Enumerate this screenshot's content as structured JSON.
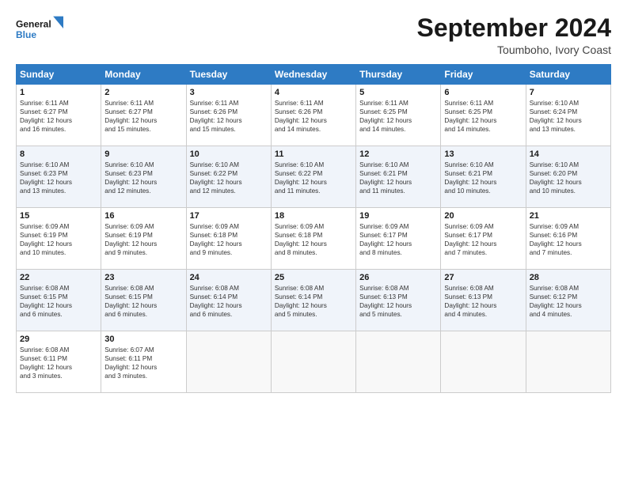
{
  "logo": {
    "line1": "General",
    "line2": "Blue"
  },
  "title": "September 2024",
  "subtitle": "Toumboho, Ivory Coast",
  "header_days": [
    "Sunday",
    "Monday",
    "Tuesday",
    "Wednesday",
    "Thursday",
    "Friday",
    "Saturday"
  ],
  "weeks": [
    [
      {
        "day": "1",
        "lines": [
          "Sunrise: 6:11 AM",
          "Sunset: 6:27 PM",
          "Daylight: 12 hours",
          "and 16 minutes."
        ]
      },
      {
        "day": "2",
        "lines": [
          "Sunrise: 6:11 AM",
          "Sunset: 6:27 PM",
          "Daylight: 12 hours",
          "and 15 minutes."
        ]
      },
      {
        "day": "3",
        "lines": [
          "Sunrise: 6:11 AM",
          "Sunset: 6:26 PM",
          "Daylight: 12 hours",
          "and 15 minutes."
        ]
      },
      {
        "day": "4",
        "lines": [
          "Sunrise: 6:11 AM",
          "Sunset: 6:26 PM",
          "Daylight: 12 hours",
          "and 14 minutes."
        ]
      },
      {
        "day": "5",
        "lines": [
          "Sunrise: 6:11 AM",
          "Sunset: 6:25 PM",
          "Daylight: 12 hours",
          "and 14 minutes."
        ]
      },
      {
        "day": "6",
        "lines": [
          "Sunrise: 6:11 AM",
          "Sunset: 6:25 PM",
          "Daylight: 12 hours",
          "and 14 minutes."
        ]
      },
      {
        "day": "7",
        "lines": [
          "Sunrise: 6:10 AM",
          "Sunset: 6:24 PM",
          "Daylight: 12 hours",
          "and 13 minutes."
        ]
      }
    ],
    [
      {
        "day": "8",
        "lines": [
          "Sunrise: 6:10 AM",
          "Sunset: 6:23 PM",
          "Daylight: 12 hours",
          "and 13 minutes."
        ]
      },
      {
        "day": "9",
        "lines": [
          "Sunrise: 6:10 AM",
          "Sunset: 6:23 PM",
          "Daylight: 12 hours",
          "and 12 minutes."
        ]
      },
      {
        "day": "10",
        "lines": [
          "Sunrise: 6:10 AM",
          "Sunset: 6:22 PM",
          "Daylight: 12 hours",
          "and 12 minutes."
        ]
      },
      {
        "day": "11",
        "lines": [
          "Sunrise: 6:10 AM",
          "Sunset: 6:22 PM",
          "Daylight: 12 hours",
          "and 11 minutes."
        ]
      },
      {
        "day": "12",
        "lines": [
          "Sunrise: 6:10 AM",
          "Sunset: 6:21 PM",
          "Daylight: 12 hours",
          "and 11 minutes."
        ]
      },
      {
        "day": "13",
        "lines": [
          "Sunrise: 6:10 AM",
          "Sunset: 6:21 PM",
          "Daylight: 12 hours",
          "and 10 minutes."
        ]
      },
      {
        "day": "14",
        "lines": [
          "Sunrise: 6:10 AM",
          "Sunset: 6:20 PM",
          "Daylight: 12 hours",
          "and 10 minutes."
        ]
      }
    ],
    [
      {
        "day": "15",
        "lines": [
          "Sunrise: 6:09 AM",
          "Sunset: 6:19 PM",
          "Daylight: 12 hours",
          "and 10 minutes."
        ]
      },
      {
        "day": "16",
        "lines": [
          "Sunrise: 6:09 AM",
          "Sunset: 6:19 PM",
          "Daylight: 12 hours",
          "and 9 minutes."
        ]
      },
      {
        "day": "17",
        "lines": [
          "Sunrise: 6:09 AM",
          "Sunset: 6:18 PM",
          "Daylight: 12 hours",
          "and 9 minutes."
        ]
      },
      {
        "day": "18",
        "lines": [
          "Sunrise: 6:09 AM",
          "Sunset: 6:18 PM",
          "Daylight: 12 hours",
          "and 8 minutes."
        ]
      },
      {
        "day": "19",
        "lines": [
          "Sunrise: 6:09 AM",
          "Sunset: 6:17 PM",
          "Daylight: 12 hours",
          "and 8 minutes."
        ]
      },
      {
        "day": "20",
        "lines": [
          "Sunrise: 6:09 AM",
          "Sunset: 6:17 PM",
          "Daylight: 12 hours",
          "and 7 minutes."
        ]
      },
      {
        "day": "21",
        "lines": [
          "Sunrise: 6:09 AM",
          "Sunset: 6:16 PM",
          "Daylight: 12 hours",
          "and 7 minutes."
        ]
      }
    ],
    [
      {
        "day": "22",
        "lines": [
          "Sunrise: 6:08 AM",
          "Sunset: 6:15 PM",
          "Daylight: 12 hours",
          "and 6 minutes."
        ]
      },
      {
        "day": "23",
        "lines": [
          "Sunrise: 6:08 AM",
          "Sunset: 6:15 PM",
          "Daylight: 12 hours",
          "and 6 minutes."
        ]
      },
      {
        "day": "24",
        "lines": [
          "Sunrise: 6:08 AM",
          "Sunset: 6:14 PM",
          "Daylight: 12 hours",
          "and 6 minutes."
        ]
      },
      {
        "day": "25",
        "lines": [
          "Sunrise: 6:08 AM",
          "Sunset: 6:14 PM",
          "Daylight: 12 hours",
          "and 5 minutes."
        ]
      },
      {
        "day": "26",
        "lines": [
          "Sunrise: 6:08 AM",
          "Sunset: 6:13 PM",
          "Daylight: 12 hours",
          "and 5 minutes."
        ]
      },
      {
        "day": "27",
        "lines": [
          "Sunrise: 6:08 AM",
          "Sunset: 6:13 PM",
          "Daylight: 12 hours",
          "and 4 minutes."
        ]
      },
      {
        "day": "28",
        "lines": [
          "Sunrise: 6:08 AM",
          "Sunset: 6:12 PM",
          "Daylight: 12 hours",
          "and 4 minutes."
        ]
      }
    ],
    [
      {
        "day": "29",
        "lines": [
          "Sunrise: 6:08 AM",
          "Sunset: 6:11 PM",
          "Daylight: 12 hours",
          "and 3 minutes."
        ]
      },
      {
        "day": "30",
        "lines": [
          "Sunrise: 6:07 AM",
          "Sunset: 6:11 PM",
          "Daylight: 12 hours",
          "and 3 minutes."
        ]
      },
      {
        "day": "",
        "lines": []
      },
      {
        "day": "",
        "lines": []
      },
      {
        "day": "",
        "lines": []
      },
      {
        "day": "",
        "lines": []
      },
      {
        "day": "",
        "lines": []
      }
    ]
  ]
}
